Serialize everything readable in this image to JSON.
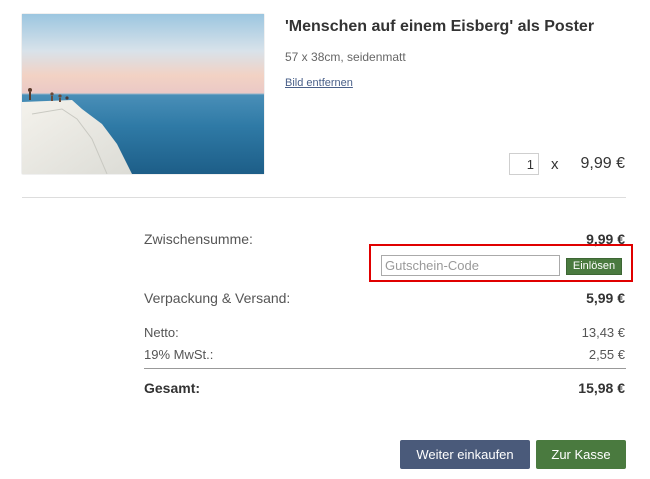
{
  "product": {
    "title": "'Menschen auf einem Eisberg' als Poster",
    "variant": "57 x 38cm, seidenmatt",
    "remove_label": "Bild entfernen",
    "quantity": "1",
    "times_symbol": "x",
    "price": "9,99 €",
    "image_icon": "poster-thumbnail"
  },
  "summary": {
    "subtotal_label": "Zwischensumme:",
    "subtotal_value": "9,99 €",
    "coupon_placeholder": "Gutschein-Code",
    "coupon_value": "",
    "redeem_label": "Einlösen",
    "shipping_label": "Verpackung & Versand:",
    "shipping_value": "5,99 €",
    "net_label": "Netto:",
    "net_value": "13,43 €",
    "vat_label": "19% MwSt.:",
    "vat_value": "2,55 €",
    "total_label": "Gesamt:",
    "total_value": "15,98 €"
  },
  "actions": {
    "continue_label": "Weiter einkaufen",
    "checkout_label": "Zur Kasse"
  },
  "colors": {
    "highlight": "#e00000",
    "green_button": "#4a7a3f",
    "blue_button": "#4a5a7a",
    "link": "#4a6089"
  }
}
